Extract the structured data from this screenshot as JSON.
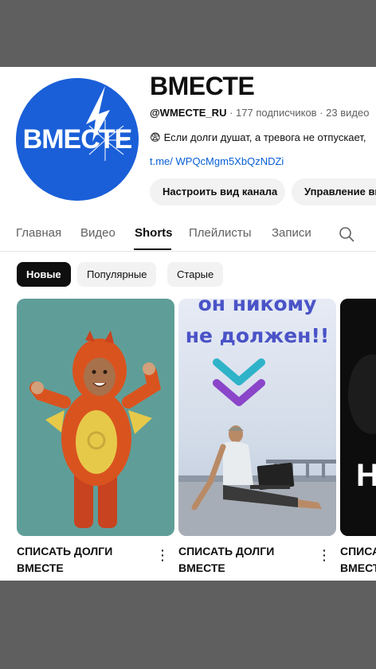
{
  "channel": {
    "avatar_text": "ВМЕСТЕ",
    "title": "ВМЕСТЕ",
    "handle": "@WMECTE_RU",
    "subscribers": "177 подписчиков",
    "videos": "23 видео",
    "separator": "·",
    "description_emoji": "😨",
    "description": "Если долги душат, а тревога не отпускает,",
    "link": "t.me/ WPQcMgm5XbQzNDZi"
  },
  "actions": {
    "customize": "Настроить вид канала",
    "manage": "Управление видео"
  },
  "tabs": [
    "Главная",
    "Видео",
    "Shorts",
    "Плейлисты",
    "Записи"
  ],
  "active_tab": "Shorts",
  "chips": [
    "Новые",
    "Популярные",
    "Старые"
  ],
  "active_chip": "Новые",
  "shorts": [
    {
      "title": "СПИСАТЬ ДОЛГИ ВМЕСТЕ",
      "thumb_type": "child-costume"
    },
    {
      "title": "СПИСАТЬ ДОЛГИ ВМЕСТЕ",
      "thumb_type": "man-laptop",
      "overlay_line1": "он никому",
      "overlay_line2": "не должен!!"
    },
    {
      "title": "СПИСАТЬ ДОЛГИ ВМЕСТЕ",
      "thumb_type": "dark",
      "overlay_letter": "Н"
    }
  ],
  "colors": {
    "brand_blue": "#1a5fd8",
    "link_blue": "#065fd4",
    "overlay_text": "#4a53c7",
    "chevron_top": "#2fb3c9",
    "chevron_bottom": "#8a45c9"
  }
}
